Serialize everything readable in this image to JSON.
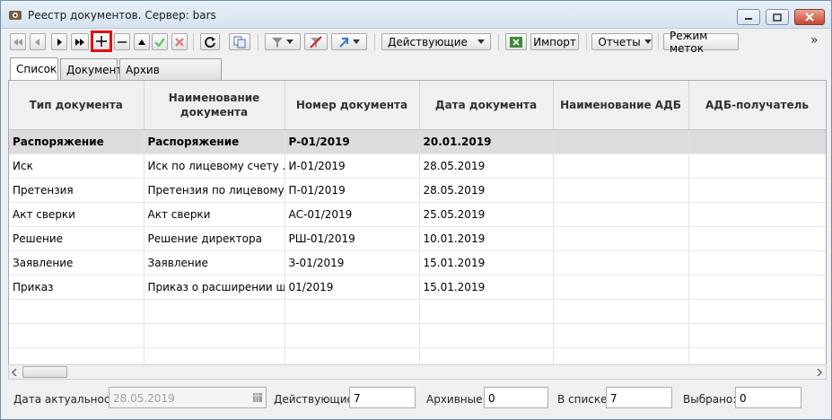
{
  "window": {
    "title": "Реестр документов. Сервер: bars"
  },
  "toolbar": {
    "filter_value": "Действующие",
    "import_label": "Импорт",
    "reports_label": "Отчеты",
    "mark_mode_label": "Режим меток",
    "overflow": "»"
  },
  "tabs": [
    {
      "label": "Список"
    },
    {
      "label": "Документ"
    },
    {
      "label": "Архив документов"
    }
  ],
  "table": {
    "columns": [
      "Тип документа",
      "Наименование документа",
      "Номер документа",
      "Дата документа",
      "Наименование АДБ",
      "АДБ-получатель"
    ],
    "rows": [
      [
        "Распоряжение",
        "Распоряжение",
        "Р-01/2019",
        "20.01.2019",
        "",
        ""
      ],
      [
        "Иск",
        "Иск по лицевому счету ...",
        "И-01/2019",
        "28.05.2019",
        "",
        ""
      ],
      [
        "Претензия",
        "Претензия по лицевому ...",
        "П-01/2019",
        "28.05.2019",
        "",
        ""
      ],
      [
        "Акт сверки",
        "Акт сверки",
        "АС-01/2019",
        "25.05.2019",
        "",
        ""
      ],
      [
        "Решение",
        "Решение директора",
        "РШ-01/2019",
        "10.01.2019",
        "",
        ""
      ],
      [
        "Заявление",
        "Заявление",
        "З-01/2019",
        "15.01.2019",
        "",
        ""
      ],
      [
        "Приказ",
        "Приказ о расширении шт...",
        "01/2019",
        "15.01.2019",
        "",
        ""
      ]
    ]
  },
  "status": {
    "date_label": "Дата актуальности",
    "date_value": "28.05.2019",
    "active_label": "Действующие:",
    "active_value": "7",
    "archived_label": "Архивные:",
    "archived_value": "0",
    "inlist_label": "В списке:",
    "inlist_value": "7",
    "selected_label": "Выбрано:",
    "selected_value": "0"
  },
  "colors": {
    "highlight_border": "#e01010",
    "selected_row": "#dcdcdc"
  }
}
